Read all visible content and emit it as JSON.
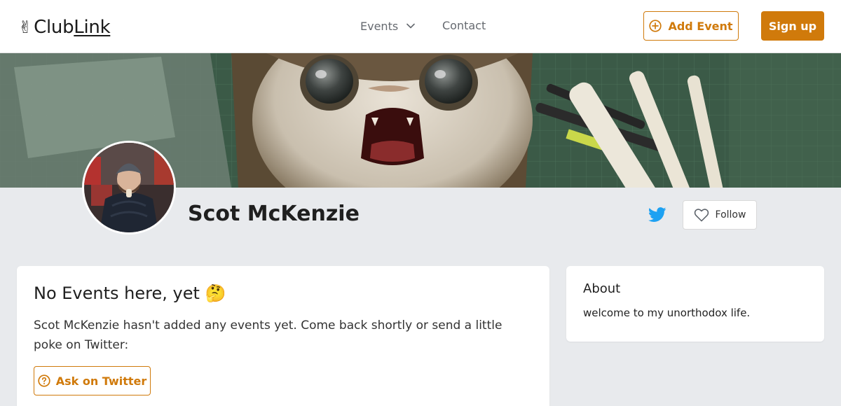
{
  "header": {
    "logo_hand": "✌",
    "logo_club": "Club",
    "logo_link": "Link",
    "nav": {
      "events_label": "Events",
      "contact_label": "Contact"
    },
    "add_event_label": "Add Event",
    "signup_label": "Sign up"
  },
  "profile": {
    "name": "Scot McKenzie",
    "follow_label": "Follow"
  },
  "events_card": {
    "heading": "No Events here, yet",
    "heading_emoji": "🤔",
    "message": "Scot McKenzie hasn't added any events yet. Come back shortly or send a little poke on Twitter:",
    "ask_label": "Ask on Twitter"
  },
  "about_card": {
    "heading": "About",
    "text": "welcome to my unorthodox life."
  },
  "colors": {
    "accent": "#d07a0b",
    "twitter": "#1da1f2",
    "page_bg": "#e8eaed"
  },
  "icons": {
    "nav_events": "chevron-down-icon",
    "add_event": "plus-circle-icon",
    "twitter": "twitter-icon",
    "follow": "heart-icon",
    "ask": "question-circle-icon"
  }
}
